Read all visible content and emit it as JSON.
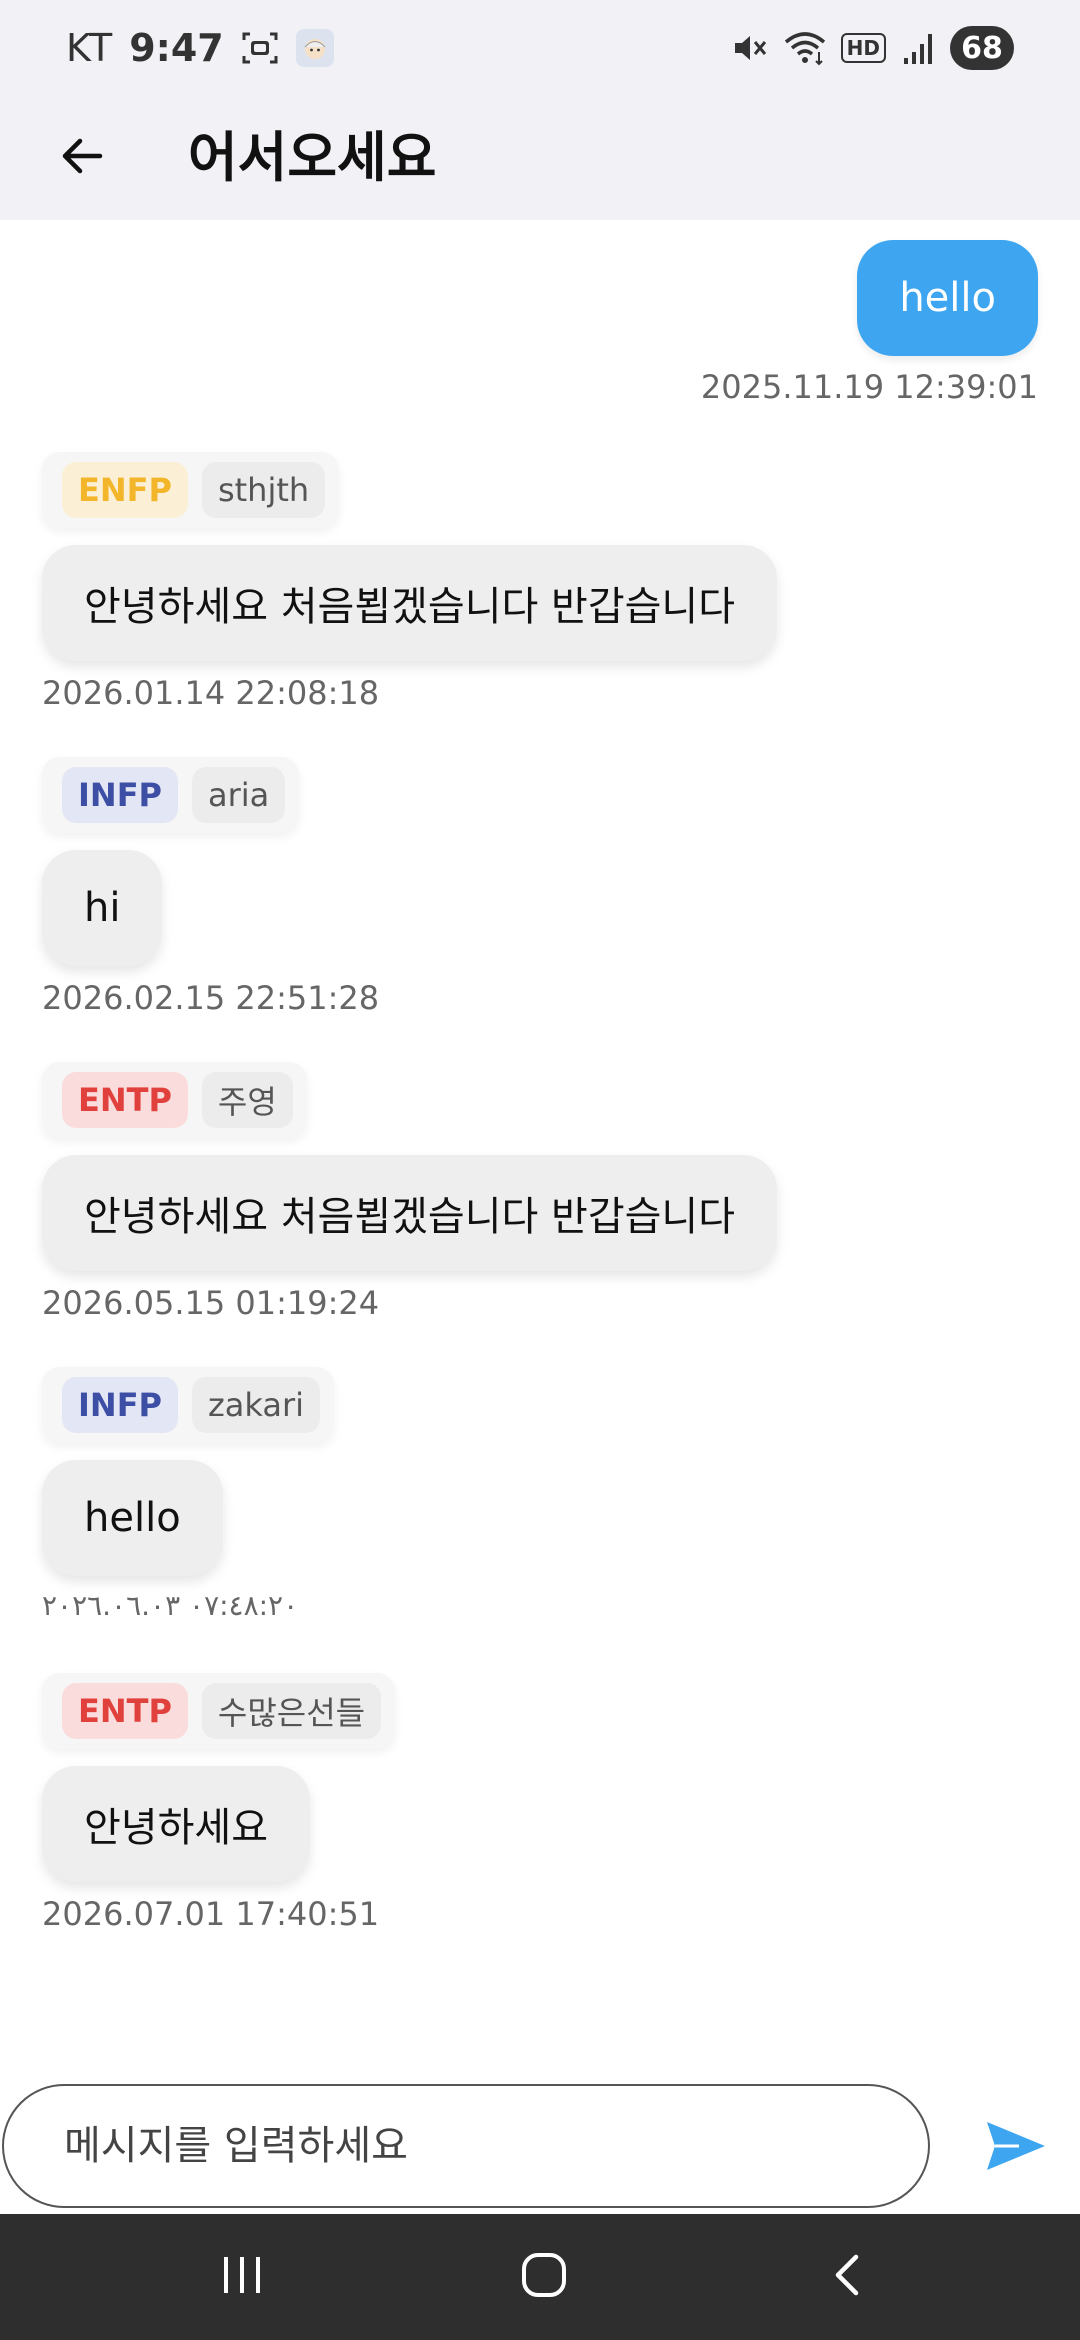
{
  "status_bar": {
    "carrier": "KT",
    "time": "9:47",
    "battery": "68",
    "hd_label": "HD",
    "icons": [
      "screenshot-icon",
      "face-icon",
      "mute-icon",
      "wifi-icon",
      "hd-icon",
      "signal-icon",
      "battery-icon"
    ]
  },
  "app_bar": {
    "title": "어서오세요",
    "back_icon": "arrow-left-icon"
  },
  "messages": [
    {
      "direction": "outgoing",
      "text": "hello",
      "timestamp": "2025.11.19 12:39:01"
    },
    {
      "direction": "incoming",
      "mbti": "ENFP",
      "nickname": "sthjth",
      "text": "안녕하세요 처음뵙겠습니다 반갑습니다",
      "timestamp": "2026.01.14 22:08:18"
    },
    {
      "direction": "incoming",
      "mbti": "INFP",
      "nickname": "aria",
      "text": "hi",
      "timestamp": "2026.02.15 22:51:28"
    },
    {
      "direction": "incoming",
      "mbti": "ENTP",
      "nickname": "주영",
      "text": "안녕하세요 처음뵙겠습니다 반갑습니다",
      "timestamp": "2026.05.15 01:19:24"
    },
    {
      "direction": "incoming",
      "mbti": "INFP",
      "nickname": "zakari",
      "text": "hello",
      "timestamp": "٠٧:٤٨:٢٠ ٢٠٢٦.٠٦.٠٣"
    },
    {
      "direction": "incoming",
      "mbti": "ENTP",
      "nickname": "수많은선들",
      "text": "안녕하세요",
      "timestamp": "2026.07.01 17:40:51"
    }
  ],
  "composer": {
    "placeholder": "메시지를 입력하세요",
    "send_icon": "send-icon"
  },
  "nav_bar": {
    "icons": [
      "recents-icon",
      "home-icon",
      "back-icon"
    ]
  },
  "colors": {
    "header_bg": "#f1f1f6",
    "outgoing_bubble": "#3ea6f1",
    "incoming_bubble": "#eeeeee",
    "enfp_text": "#f3b62b",
    "infp_text": "#3d4fa5",
    "entp_text": "#e0413d",
    "send_icon": "#3ea6f1",
    "nav_bg": "#2e2e2e"
  }
}
